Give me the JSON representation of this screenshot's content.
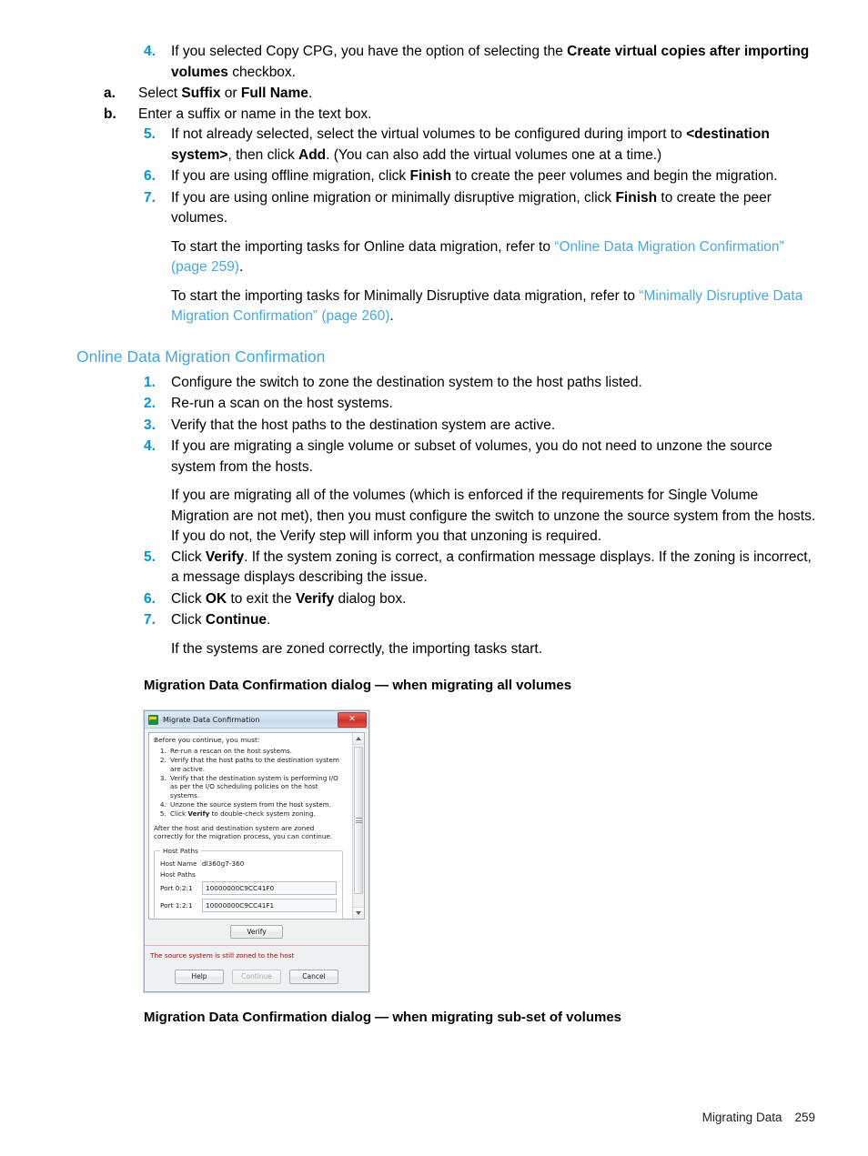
{
  "document": {
    "footer": {
      "chapter": "Migrating Data",
      "page_number": "259"
    }
  },
  "steps_top": [
    {
      "num": "4.",
      "text_parts": [
        {
          "t": "If you selected Copy CPG, you have the option of selecting the ",
          "b": false
        },
        {
          "t": "Create virtual copies after importing volumes",
          "b": true
        },
        {
          "t": " checkbox.",
          "b": false
        }
      ],
      "substeps": [
        {
          "num": "a.",
          "parts": [
            {
              "t": "Select ",
              "b": false
            },
            {
              "t": "Suffix",
              "b": true
            },
            {
              "t": " or ",
              "b": false
            },
            {
              "t": "Full Name",
              "b": true
            },
            {
              "t": ".",
              "b": false
            }
          ]
        },
        {
          "num": "b.",
          "parts": [
            {
              "t": "Enter a suffix or name in the text box.",
              "b": false
            }
          ]
        }
      ]
    },
    {
      "num": "5.",
      "text_parts": [
        {
          "t": "If not already selected, select the virtual volumes to be configured during import to ",
          "b": false
        },
        {
          "t": "<destination system>",
          "b": true
        },
        {
          "t": ", then click ",
          "b": false
        },
        {
          "t": "Add",
          "b": true
        },
        {
          "t": ". (You can also add the virtual volumes one at a time.)",
          "b": false
        }
      ],
      "substeps": []
    },
    {
      "num": "6.",
      "text_parts": [
        {
          "t": "If you are using offline migration, click ",
          "b": false
        },
        {
          "t": "Finish",
          "b": true
        },
        {
          "t": " to create the peer volumes and begin the migration.",
          "b": false
        }
      ],
      "substeps": []
    },
    {
      "num": "7.",
      "text_parts": [
        {
          "t": "If you are using online migration or minimally disruptive migration, click ",
          "b": false
        },
        {
          "t": "Finish",
          "b": true
        },
        {
          "t": " to create the peer volumes.",
          "b": false
        }
      ],
      "substeps": []
    }
  ],
  "cross_ref_paragraphs": [
    {
      "parts": [
        {
          "t": "To start the importing tasks for Online data migration, refer to ",
          "link": false
        },
        {
          "t": "“Online Data Migration Confirmation” (page 259)",
          "link": true
        },
        {
          "t": ".",
          "link": false
        }
      ]
    },
    {
      "parts": [
        {
          "t": "To start the importing tasks for Minimally Disruptive data migration, refer to ",
          "link": false
        },
        {
          "t": "“Minimally Disruptive Data Migration Confirmation” (page 260)",
          "link": true
        },
        {
          "t": ".",
          "link": false
        }
      ]
    }
  ],
  "section": {
    "heading": "Online Data Migration Confirmation",
    "steps": [
      {
        "num": "1.",
        "parts": [
          {
            "t": "Configure the switch to zone the destination system to the host paths listed.",
            "b": false
          }
        ]
      },
      {
        "num": "2.",
        "parts": [
          {
            "t": "Re-run a scan on the host systems.",
            "b": false
          }
        ]
      },
      {
        "num": "3.",
        "parts": [
          {
            "t": "Verify that the host paths to the destination system are active.",
            "b": false
          }
        ]
      },
      {
        "num": "4.",
        "parts": [
          {
            "t": "If you are migrating a single volume or subset of volumes, you do not need to unzone the source system from the hosts.",
            "b": false
          }
        ]
      }
    ],
    "interstitial": "If you are migrating all of the volumes (which is enforced if the requirements for Single Volume Migration are not met), then you must configure the switch to unzone the source system from the hosts. If you do not, the Verify step will inform you that unzoning is required.",
    "steps_after": [
      {
        "num": "5.",
        "parts": [
          {
            "t": "Click ",
            "b": false
          },
          {
            "t": "Verify",
            "b": true
          },
          {
            "t": ". If the system zoning is correct, a confirmation message displays. If the zoning is incorrect, a message displays describing the issue.",
            "b": false
          }
        ]
      },
      {
        "num": "6.",
        "parts": [
          {
            "t": "Click ",
            "b": false
          },
          {
            "t": "OK",
            "b": true
          },
          {
            "t": " to exit the ",
            "b": false
          },
          {
            "t": "Verify",
            "b": true
          },
          {
            "t": " dialog box.",
            "b": false
          }
        ]
      },
      {
        "num": "7.",
        "parts": [
          {
            "t": "Click ",
            "b": false
          },
          {
            "t": "Continue",
            "b": true
          },
          {
            "t": ".",
            "b": false
          }
        ]
      }
    ],
    "closing_note": "If the systems are zoned correctly, the importing tasks start."
  },
  "figures": {
    "caption_above": "Migration Data Confirmation dialog — when migrating all volumes",
    "caption_below": "Migration Data Confirmation dialog — when migrating sub-set of volumes"
  },
  "dialog": {
    "title": "Migrate Data Confirmation",
    "close_label": "✕",
    "intro": "Before you continue, you must:",
    "steps": [
      "Re-run a rescan on the host systems.",
      "Verify that the host paths to the destination system are active.",
      "Verify that the destination system is performing I/O as per the I/O scheduling policies on the host systems.",
      "Unzone the source system from the host system.",
      "Click Verify to double-check system zoning."
    ],
    "step5_prefix": "Click ",
    "step5_bold": "Verify",
    "step5_suffix": " to double-check system zoning.",
    "after_text": "After the host and destination system are zoned correctly for the migration process, you can continue.",
    "host_paths": {
      "legend": "Host Paths",
      "host_name_label": "Host Name",
      "host_name_value": "dl360g7-360",
      "host_paths_label": "Host Paths",
      "ports": [
        {
          "label": "Port 0:2:1",
          "wwn": "10000000C9CC41F0"
        },
        {
          "label": "Port 1:2:1",
          "wwn": "10000000C9CC41F1"
        }
      ]
    },
    "verify_button": "Verify",
    "error_message": "The source system is still zoned to the host",
    "buttons": {
      "help": "Help",
      "continue": "Continue",
      "cancel": "Cancel"
    }
  },
  "colors": {
    "accent_blue": "#0096d6",
    "link_blue": "#4aa7e0",
    "heading_blue": "#3fa9e0",
    "error_red": "#c00000",
    "close_red": "#d6352c"
  }
}
